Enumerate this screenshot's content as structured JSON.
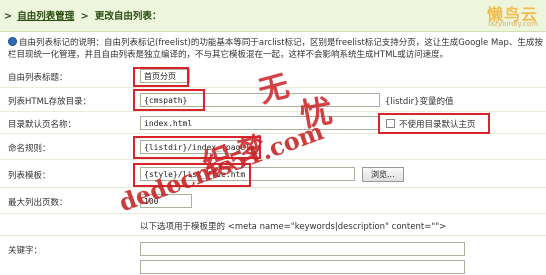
{
  "header": {
    "breadcrumb_root": "自由列表管理",
    "breadcrumb_current": "更改自由列表：",
    "logo_text": "懒鸟云",
    "logo_sub": "lazybirdly.com"
  },
  "description": "自由列表标记的说明：自由列表标记(freelist)的功能基本等同于arclist标记，区别是freelist标记支持分页，这让生成Google Map、生成按栏目现统一化管理，并且自由列表是独立编译的，不与其它模板混在一起，这样不会影响系统生成HTML或访问速度。",
  "form": {
    "title_label": "自由列表标题：",
    "title_value": "首页分页",
    "dir_label": "列表HTML存放目录：",
    "dir_value": "{cmspath}",
    "dir_note": "{listdir}变量的值",
    "default_label": "目录默认页名称：",
    "default_value": "index.html",
    "no_default_label": "不使用目录默认主页",
    "naming_label": "命名规则：",
    "naming_value": "{listdir}/index_{page}.html",
    "template_label": "列表模板：",
    "template_value": "{style}/list_free.htm",
    "browse_label": "浏览...",
    "maxpages_label": "最大列出页数：",
    "maxpages_value": "100",
    "meta_note": "以下选项用于模板里的 <meta name=\"keywords|description\" content=\"\">",
    "keywords_label": "关键字："
  },
  "watermark": {
    "line1": "织梦无忧",
    "line2": "dedecms51.com"
  }
}
